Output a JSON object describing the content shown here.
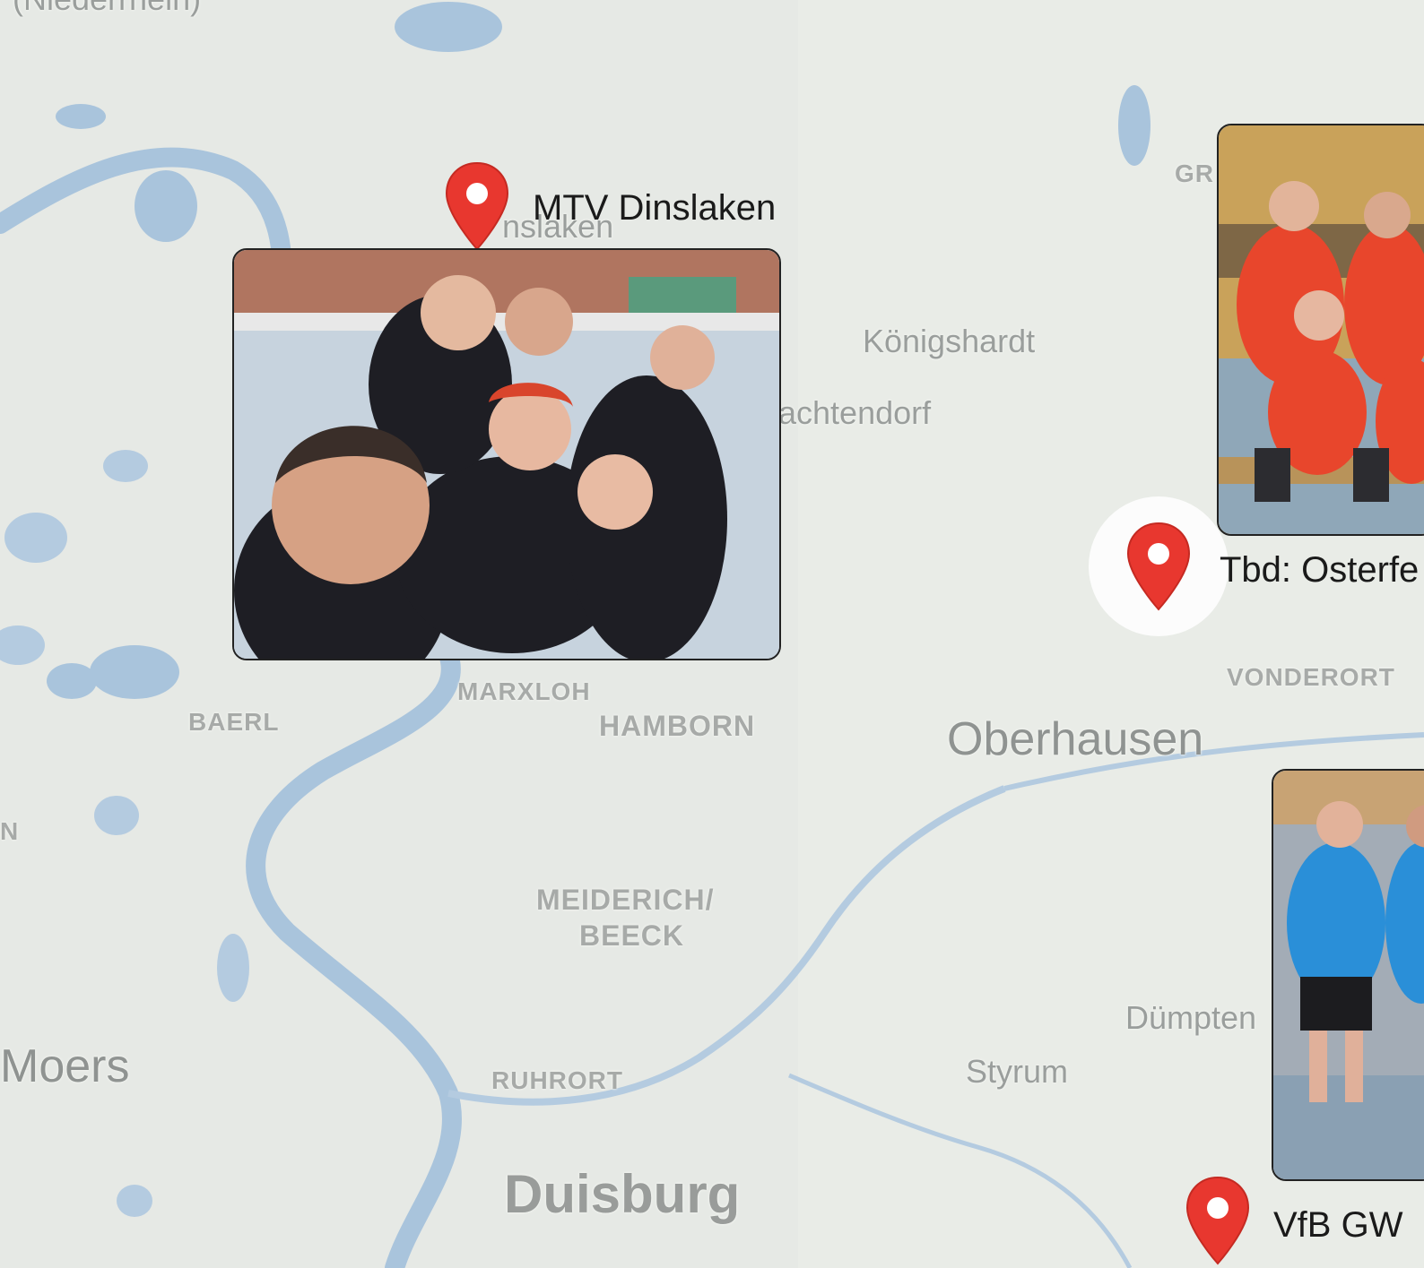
{
  "places": {
    "niederrhein": "(Niederrhein)",
    "dinslaken_bg": "nslaken",
    "koenigshardt": "Königshardt",
    "hiesfeld_partial": "achtendorf",
    "gr_partial": "GR",
    "vonderort": "VONDERORT",
    "oberhausen": "Oberhausen",
    "baerl": "BAERL",
    "marxloh": "MARXLOH",
    "hamborn": "HAMBORN",
    "n_partial": "N",
    "meiderich": "MEIDERICH/",
    "beeck": "BEECK",
    "duempten": "Dümpten",
    "styrum": "Styrum",
    "moers": "Moers",
    "ruhrort": "RUHRORT",
    "duisburg": "Duisburg"
  },
  "markers": [
    {
      "label": "MTV Dinslaken",
      "icon": "map-pin-icon",
      "color": "#e8372f"
    },
    {
      "label": "Tbd: Osterfe",
      "icon": "map-pin-icon",
      "color": "#e8372f"
    },
    {
      "label": "VfB GW",
      "icon": "map-pin-icon",
      "color": "#e8372f"
    }
  ],
  "colors": {
    "water": "#a9c4dc",
    "land": "#e9ece7",
    "pin": "#e8372f"
  }
}
